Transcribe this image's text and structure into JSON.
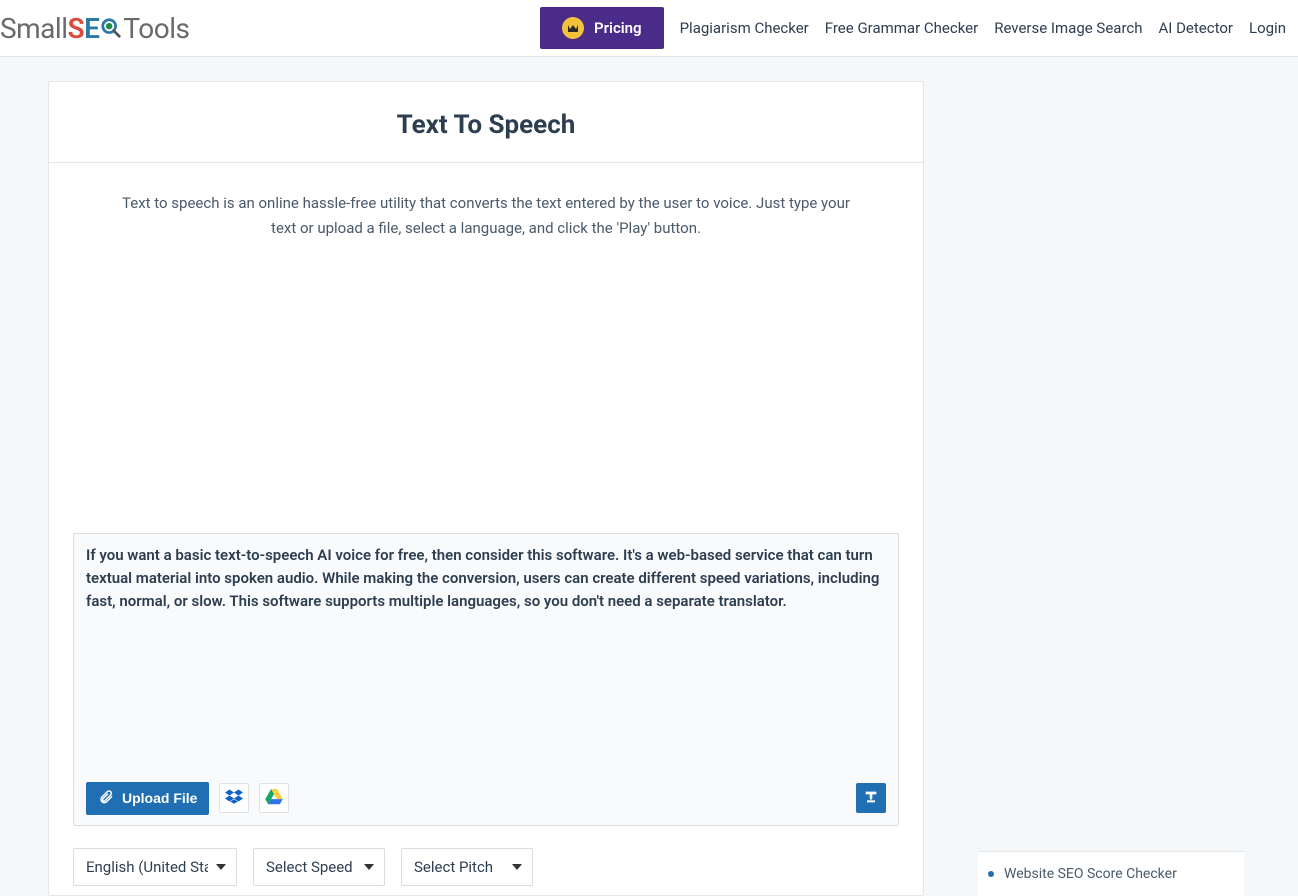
{
  "logo": {
    "prefix": "Small",
    "s": "S",
    "e": "E",
    "suffix": "Tools"
  },
  "nav": {
    "pricing": "Pricing",
    "items": [
      "Plagiarism Checker",
      "Free Grammar Checker",
      "Reverse Image Search",
      "AI Detector",
      "Login"
    ]
  },
  "tool": {
    "title": "Text To Speech",
    "description": "Text to speech is an online hassle-free utility that converts the text entered by the user to voice. Just type your text or upload a file, select a language, and click the 'Play' button."
  },
  "textarea": {
    "value": "If you want a basic text-to-speech AI voice for free, then consider this software. It's a web-based service that can turn textual material into spoken audio. While making the conversion, users can create different speed variations, including fast, normal, or slow. This software supports multiple languages, so you don't need a separate translator."
  },
  "actions": {
    "upload": "Upload File"
  },
  "selects": {
    "language": "English (United States)",
    "speed": "Select Speed",
    "pitch": "Select Pitch"
  },
  "sidebar": {
    "items": [
      "Website SEO Score Checker"
    ]
  },
  "icons": {
    "dropbox": "dropbox-icon",
    "gdrive": "google-drive-icon",
    "texttool": "text-transform-icon"
  }
}
